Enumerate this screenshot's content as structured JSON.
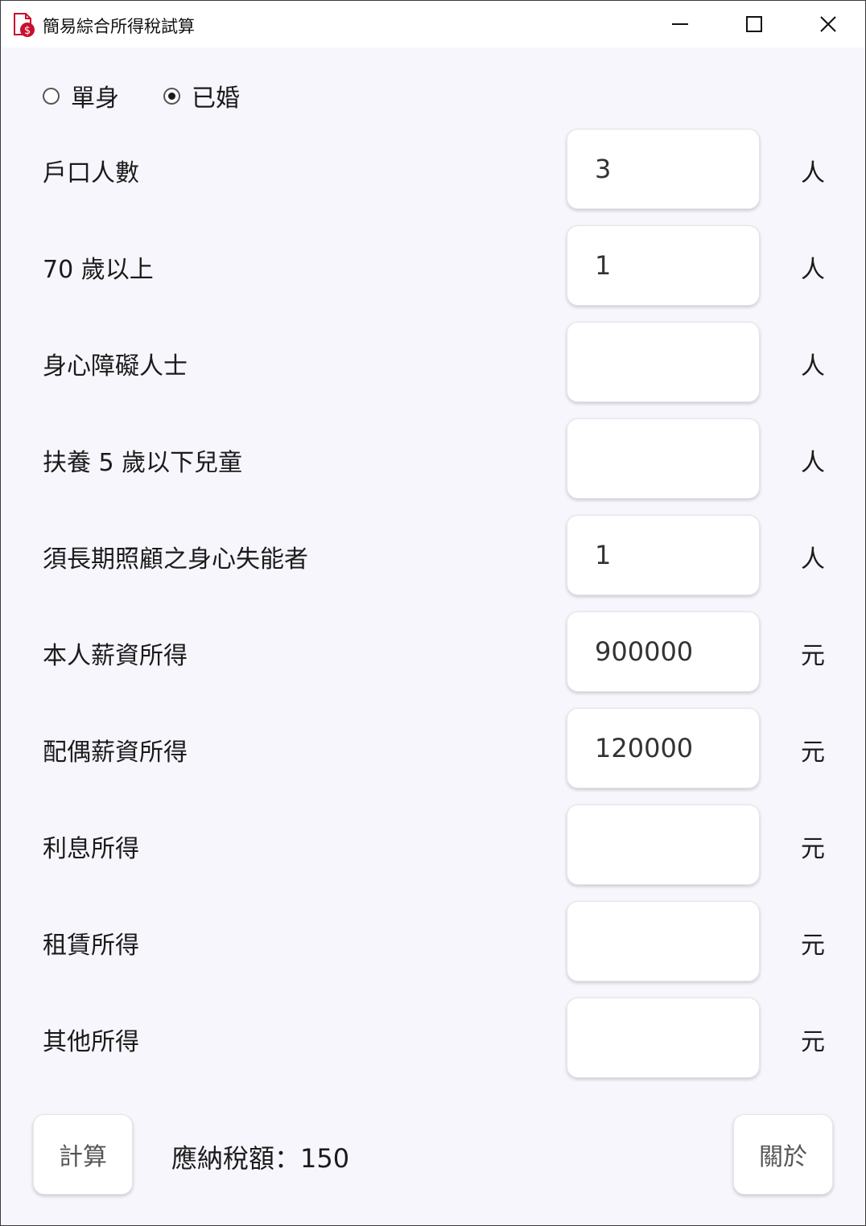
{
  "window": {
    "title": "簡易綜合所得稅試算",
    "accent": "#c8102e"
  },
  "marital": {
    "options": [
      {
        "label": "單身",
        "checked": false
      },
      {
        "label": "已婚",
        "checked": true
      }
    ]
  },
  "fields": [
    {
      "label": "戶口人數",
      "value": "3",
      "unit": "人"
    },
    {
      "label": "70 歲以上",
      "value": "1",
      "unit": "人"
    },
    {
      "label": "身心障礙人士",
      "value": "",
      "unit": "人"
    },
    {
      "label": "扶養 5 歲以下兒童",
      "value": "",
      "unit": "人"
    },
    {
      "label": "須長期照顧之身心失能者",
      "value": "1",
      "unit": "人"
    },
    {
      "label": "本人薪資所得",
      "value": "900000",
      "unit": "元"
    },
    {
      "label": "配偶薪資所得",
      "value": "120000",
      "unit": "元"
    },
    {
      "label": "利息所得",
      "value": "",
      "unit": "元"
    },
    {
      "label": "租賃所得",
      "value": "",
      "unit": "元"
    },
    {
      "label": "其他所得",
      "value": "",
      "unit": "元"
    }
  ],
  "actions": {
    "calculate_label": "計算",
    "result_text": "應納稅額：150",
    "about_label": "關於"
  }
}
